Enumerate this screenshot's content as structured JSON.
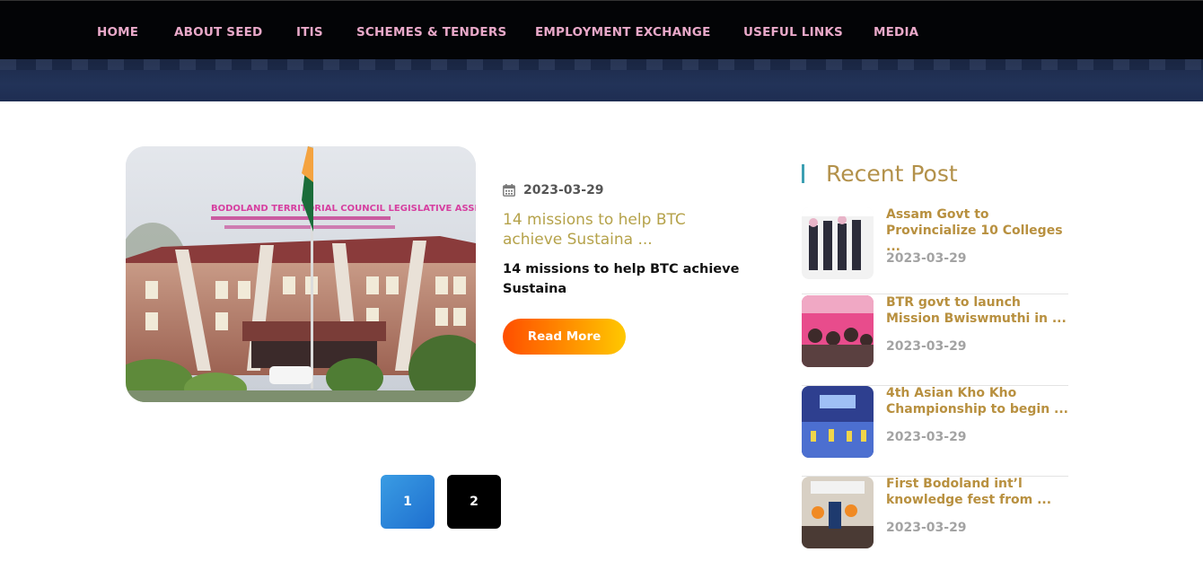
{
  "nav": {
    "items": [
      {
        "label": "HOME"
      },
      {
        "label": "ABOUT SEED"
      },
      {
        "label": "ITIS"
      },
      {
        "label": "SCHEMES & TENDERS"
      },
      {
        "label": "EMPLOYMENT EXCHANGE"
      },
      {
        "label": "USEFUL LINKS"
      },
      {
        "label": "MEDIA"
      }
    ]
  },
  "post": {
    "image_sign": "BODOLAND TERRITORIAL COUNCIL LEGISLATIVE ASSEMBLY",
    "date": "2023-03-29",
    "title": "14 missions to help BTC achieve Sustaina ...",
    "excerpt": "14 missions to help BTC achieve Sustaina",
    "read_more": "Read More"
  },
  "pagination": {
    "pages": [
      "1",
      "2"
    ],
    "active": "1"
  },
  "sidebar": {
    "heading": "Recent Post",
    "posts": [
      {
        "title": "Assam Govt to Provincialize 10 Colleges ...",
        "date": "2023-03-29"
      },
      {
        "title": "BTR govt to launch Mission Bwiswmuthi in ...",
        "date": "2023-03-29"
      },
      {
        "title": "4th Asian Kho Kho Championship to begin ...",
        "date": "2023-03-29"
      },
      {
        "title": "First Bodoland int’l knowledge fest from ...",
        "date": "2023-03-29"
      }
    ]
  },
  "colors": {
    "nav_background": "#030406",
    "nav_text": "#e9a9c9",
    "accent_gold": "#b8903f",
    "pager_active": "#1e6fcf",
    "read_more_gradient": [
      "#ff4e00",
      "#ffc800"
    ]
  }
}
